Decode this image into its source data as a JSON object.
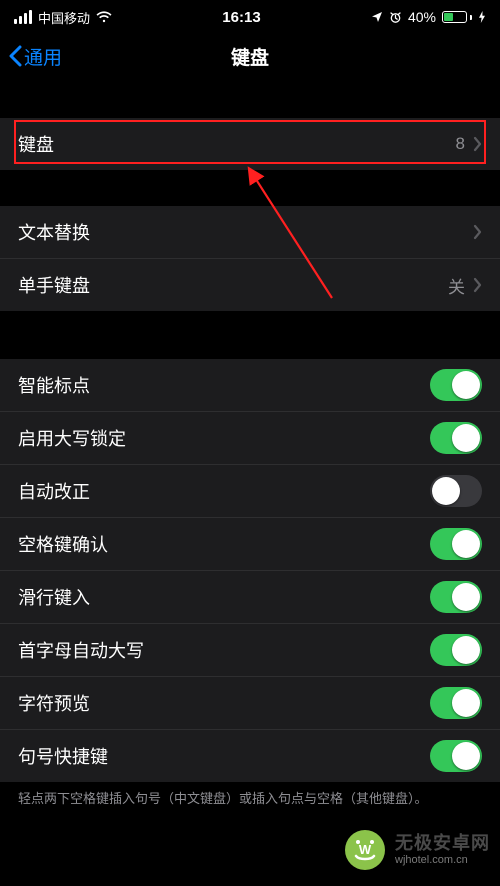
{
  "statusbar": {
    "carrier": "中国移动",
    "time": "16:13",
    "battery_pct": "40%"
  },
  "nav": {
    "back": "通用",
    "title": "键盘"
  },
  "group1": {
    "keyboards": {
      "label": "键盘",
      "value": "8"
    }
  },
  "group2": {
    "text_replace": {
      "label": "文本替换"
    },
    "one_handed": {
      "label": "单手键盘",
      "value": "关"
    }
  },
  "toggles": {
    "smart_punct": {
      "label": "智能标点",
      "on": true
    },
    "caps_lock": {
      "label": "启用大写锁定",
      "on": true
    },
    "autocorrect": {
      "label": "自动改正",
      "on": false
    },
    "space_confirm": {
      "label": "空格键确认",
      "on": true
    },
    "slide_type": {
      "label": "滑行键入",
      "on": true
    },
    "auto_cap": {
      "label": "首字母自动大写",
      "on": true
    },
    "char_preview": {
      "label": "字符预览",
      "on": true
    },
    "period_shortcut": {
      "label": "句号快捷键",
      "on": true
    }
  },
  "footer": "轻点两下空格键插入句号（中文键盘）或插入句点与空格（其他键盘）。",
  "watermark": {
    "name": "无极安卓网",
    "site": "wjhotel.com.cn"
  }
}
